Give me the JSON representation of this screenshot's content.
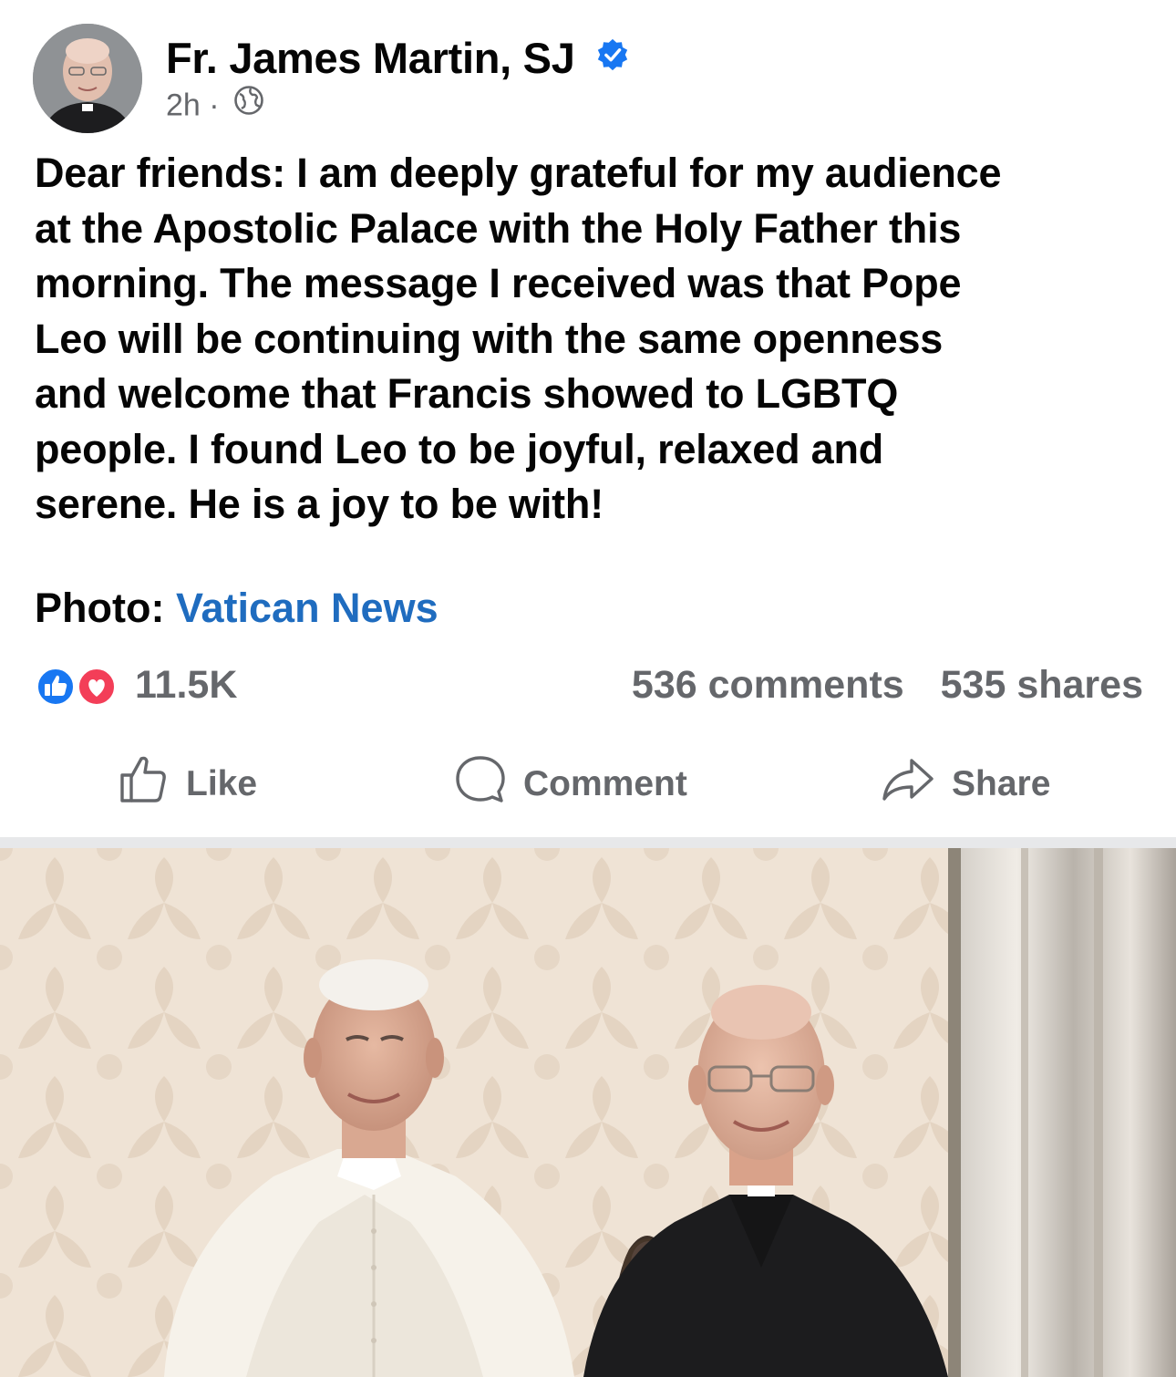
{
  "post": {
    "author": "Fr. James Martin, SJ",
    "time": "2h",
    "separator": "·",
    "body": "Dear friends: I am deeply grateful for my audience\nat the Apostolic Palace with the Holy Father this\nmorning. The message I received was that Pope\nLeo will be continuing with the same openness\nand welcome that Francis showed to LGBTQ\npeople.  I found Leo to be joyful, relaxed and\nserene.  He is a joy to be with!",
    "photo_label": "Photo:",
    "photo_source": "Vatican News"
  },
  "stats": {
    "reactions": "11.5K",
    "comments": "536 comments",
    "shares": "535 shares"
  },
  "actions": {
    "like": "Like",
    "comment": "Comment",
    "share": "Share"
  },
  "icons": {
    "verified": "verified-badge-icon",
    "audience": "globe-icon",
    "like": "thumbs-up-icon",
    "love": "heart-icon",
    "comment": "speech-bubble-icon",
    "share": "share-arrow-icon"
  },
  "colors": {
    "link": "#1f6cbf",
    "verified": "#1877f2",
    "like_reaction": "#1877f2",
    "love_reaction": "#f33e58",
    "secondary_text": "#65676b"
  }
}
